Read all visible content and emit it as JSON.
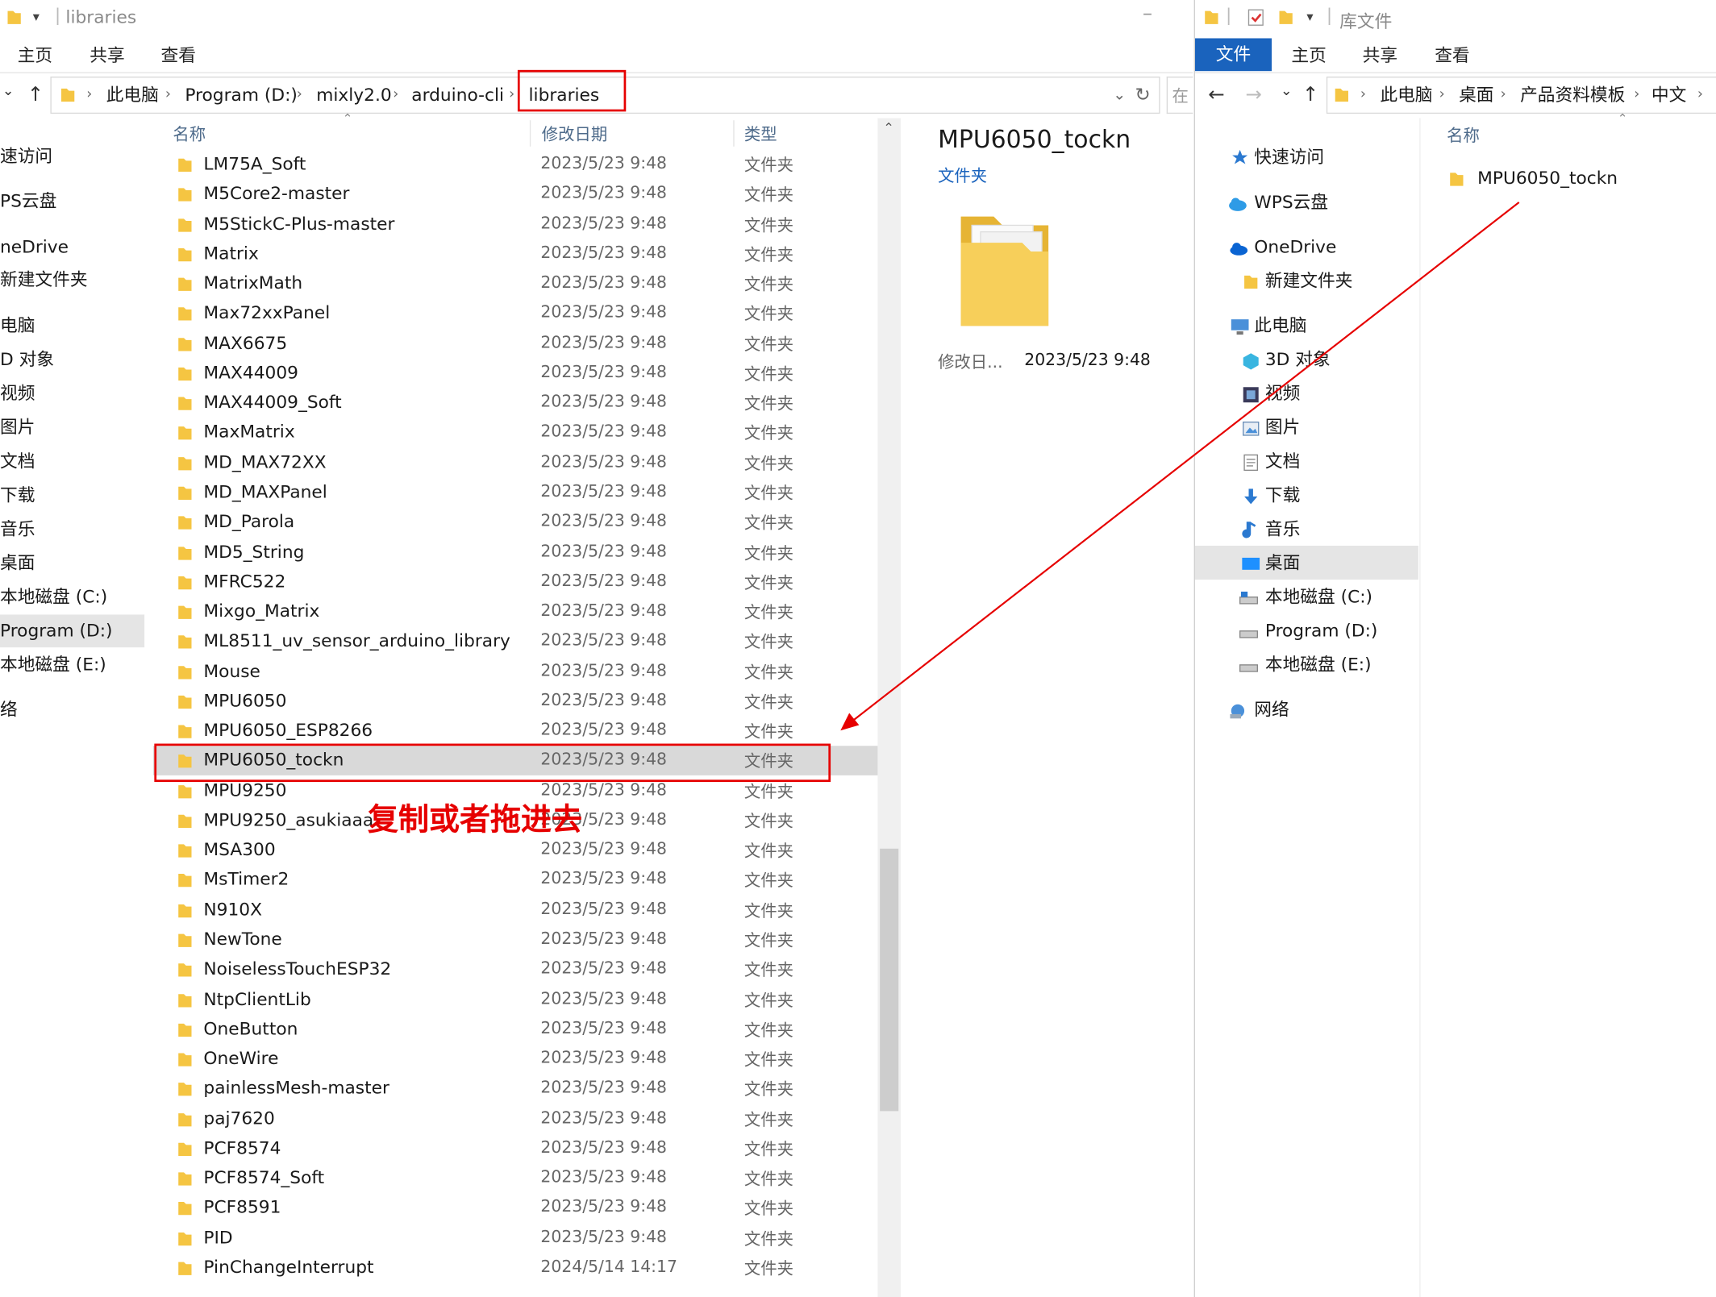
{
  "left_window": {
    "title": "libraries",
    "ribbon_tabs": [
      "主页",
      "共享",
      "查看"
    ],
    "breadcrumb": [
      "此电脑",
      "Program (D:)",
      "mixly2.0",
      "arduino-cli",
      "libraries"
    ],
    "search_stub": "在",
    "columns": {
      "name": "名称",
      "date": "修改日期",
      "type": "类型"
    },
    "nav_items": [
      "速访问",
      "PS云盘",
      "neDrive",
      "新建文件夹",
      "电脑",
      "D 对象",
      "视频",
      "图片",
      "文档",
      "下载",
      "音乐",
      "桌面",
      "本地磁盘 (C:)",
      "Program (D:)",
      "本地磁盘 (E:)",
      "络"
    ],
    "files": [
      {
        "name": "LM75A_Soft",
        "date": "2023/5/23 9:48",
        "type": "文件夹"
      },
      {
        "name": "M5Core2-master",
        "date": "2023/5/23 9:48",
        "type": "文件夹"
      },
      {
        "name": "M5StickC-Plus-master",
        "date": "2023/5/23 9:48",
        "type": "文件夹"
      },
      {
        "name": "Matrix",
        "date": "2023/5/23 9:48",
        "type": "文件夹"
      },
      {
        "name": "MatrixMath",
        "date": "2023/5/23 9:48",
        "type": "文件夹"
      },
      {
        "name": "Max72xxPanel",
        "date": "2023/5/23 9:48",
        "type": "文件夹"
      },
      {
        "name": "MAX6675",
        "date": "2023/5/23 9:48",
        "type": "文件夹"
      },
      {
        "name": "MAX44009",
        "date": "2023/5/23 9:48",
        "type": "文件夹"
      },
      {
        "name": "MAX44009_Soft",
        "date": "2023/5/23 9:48",
        "type": "文件夹"
      },
      {
        "name": "MaxMatrix",
        "date": "2023/5/23 9:48",
        "type": "文件夹"
      },
      {
        "name": "MD_MAX72XX",
        "date": "2023/5/23 9:48",
        "type": "文件夹"
      },
      {
        "name": "MD_MAXPanel",
        "date": "2023/5/23 9:48",
        "type": "文件夹"
      },
      {
        "name": "MD_Parola",
        "date": "2023/5/23 9:48",
        "type": "文件夹"
      },
      {
        "name": "MD5_String",
        "date": "2023/5/23 9:48",
        "type": "文件夹"
      },
      {
        "name": "MFRC522",
        "date": "2023/5/23 9:48",
        "type": "文件夹"
      },
      {
        "name": "Mixgo_Matrix",
        "date": "2023/5/23 9:48",
        "type": "文件夹"
      },
      {
        "name": "ML8511_uv_sensor_arduino_library",
        "date": "2023/5/23 9:48",
        "type": "文件夹"
      },
      {
        "name": "Mouse",
        "date": "2023/5/23 9:48",
        "type": "文件夹"
      },
      {
        "name": "MPU6050",
        "date": "2023/5/23 9:48",
        "type": "文件夹"
      },
      {
        "name": "MPU6050_ESP8266",
        "date": "2023/5/23 9:48",
        "type": "文件夹"
      },
      {
        "name": "MPU6050_tockn",
        "date": "2023/5/23 9:48",
        "type": "文件夹"
      },
      {
        "name": "MPU9250",
        "date": "2023/5/23 9:48",
        "type": "文件夹"
      },
      {
        "name": "MPU9250_asukiaaa",
        "date": "2023/5/23 9:48",
        "type": "文件夹"
      },
      {
        "name": "MSA300",
        "date": "2023/5/23 9:48",
        "type": "文件夹"
      },
      {
        "name": "MsTimer2",
        "date": "2023/5/23 9:48",
        "type": "文件夹"
      },
      {
        "name": "N910X",
        "date": "2023/5/23 9:48",
        "type": "文件夹"
      },
      {
        "name": "NewTone",
        "date": "2023/5/23 9:48",
        "type": "文件夹"
      },
      {
        "name": "NoiselessTouchESP32",
        "date": "2023/5/23 9:48",
        "type": "文件夹"
      },
      {
        "name": "NtpClientLib",
        "date": "2023/5/23 9:48",
        "type": "文件夹"
      },
      {
        "name": "OneButton",
        "date": "2023/5/23 9:48",
        "type": "文件夹"
      },
      {
        "name": "OneWire",
        "date": "2023/5/23 9:48",
        "type": "文件夹"
      },
      {
        "name": "painlessMesh-master",
        "date": "2023/5/23 9:48",
        "type": "文件夹"
      },
      {
        "name": "paj7620",
        "date": "2023/5/23 9:48",
        "type": "文件夹"
      },
      {
        "name": "PCF8574",
        "date": "2023/5/23 9:48",
        "type": "文件夹"
      },
      {
        "name": "PCF8574_Soft",
        "date": "2023/5/23 9:48",
        "type": "文件夹"
      },
      {
        "name": "PCF8591",
        "date": "2023/5/23 9:48",
        "type": "文件夹"
      },
      {
        "name": "PID",
        "date": "2023/5/23 9:48",
        "type": "文件夹"
      },
      {
        "name": "PinChangeInterrupt",
        "date": "2024/5/14 14:17",
        "type": "文件夹"
      }
    ],
    "preview": {
      "title": "MPU6050_tockn",
      "subtitle": "文件夹",
      "modified_label": "修改日...",
      "modified_value": "2023/5/23 9:48"
    },
    "annotation": "复制或者拖进去"
  },
  "right_window": {
    "title": "库文件",
    "ribbon_tabs": [
      "文件",
      "主页",
      "共享",
      "查看"
    ],
    "breadcrumb": [
      "此电脑",
      "桌面",
      "产品资料模板",
      "中文"
    ],
    "column_name": "名称",
    "nav_items": [
      "快速访问",
      "WPS云盘",
      "OneDrive",
      "新建文件夹",
      "此电脑",
      "3D 对象",
      "视频",
      "图片",
      "文档",
      "下载",
      "音乐",
      "桌面",
      "本地磁盘 (C:)",
      "Program (D:)",
      "本地磁盘 (E:)",
      "网络"
    ],
    "files": [
      {
        "name": "MPU6050_tockn"
      }
    ]
  },
  "colors": {
    "accent": "#1a63bd",
    "annotation_red": "#e60000",
    "folder_yellow": "#f5c542",
    "selection_gray": "#d9d9d9"
  }
}
